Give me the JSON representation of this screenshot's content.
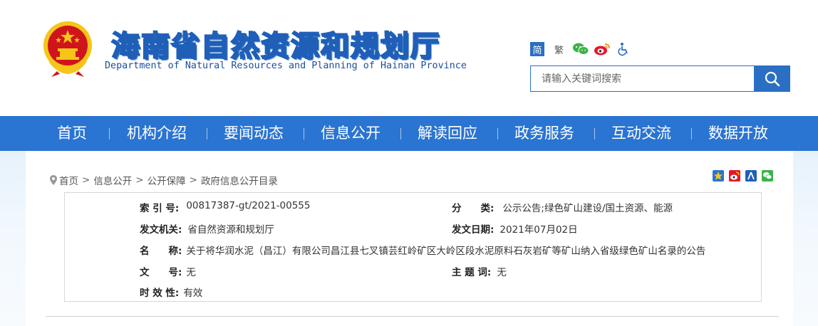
{
  "header": {
    "title_cn": "海南省自然资源和规划厅",
    "title_en": "Department of Natural Resources and Planning of Hainan Province",
    "lang_simplified": "简",
    "lang_traditional": "繁",
    "icons": [
      "wechat-icon",
      "weibo-icon",
      "accessibility-icon"
    ]
  },
  "search": {
    "placeholder": "请输入关键词搜索"
  },
  "nav": {
    "items": [
      "首页",
      "机构介绍",
      "要闻动态",
      "信息公开",
      "解读回应",
      "政务服务",
      "互动交流",
      "数据开放"
    ]
  },
  "breadcrumb": {
    "items": [
      "首页",
      "信息公开",
      "公开保障",
      "政府信息公开目录"
    ],
    "separator": ">"
  },
  "share": {
    "icons": [
      "qzone-icon",
      "weibo-share-icon",
      "renren-icon",
      "wechat-share-icon"
    ]
  },
  "meta": {
    "index_label": "索 引 号:",
    "index_value": "00817387-gt/2021-00555",
    "category_label": "分　　类:",
    "category_value": "公示公告;绿色矿山建设/国土资源、能源",
    "issuer_label": "发文机关:",
    "issuer_value": "省自然资源和规划厅",
    "date_label": "发文日期:",
    "date_value": "2021年07月02日",
    "name_label": "名　　称:",
    "name_value": "关于将华润水泥（昌江）有限公司昌江县七叉镇芸红岭矿区大岭区段水泥原料石灰岩矿等矿山纳入省级绿色矿山名录的公告",
    "doc_no_label": "文　　号:",
    "doc_no_value": "无",
    "keywords_label": "主 题 词:",
    "keywords_value": "无",
    "validity_label": "时 效 性:",
    "validity_value": "有效"
  },
  "colors": {
    "nav_blue": "#2a74d2",
    "title_blue": "#1f5fb8",
    "emblem_red": "#d0141c",
    "emblem_gold": "#f5c518"
  }
}
